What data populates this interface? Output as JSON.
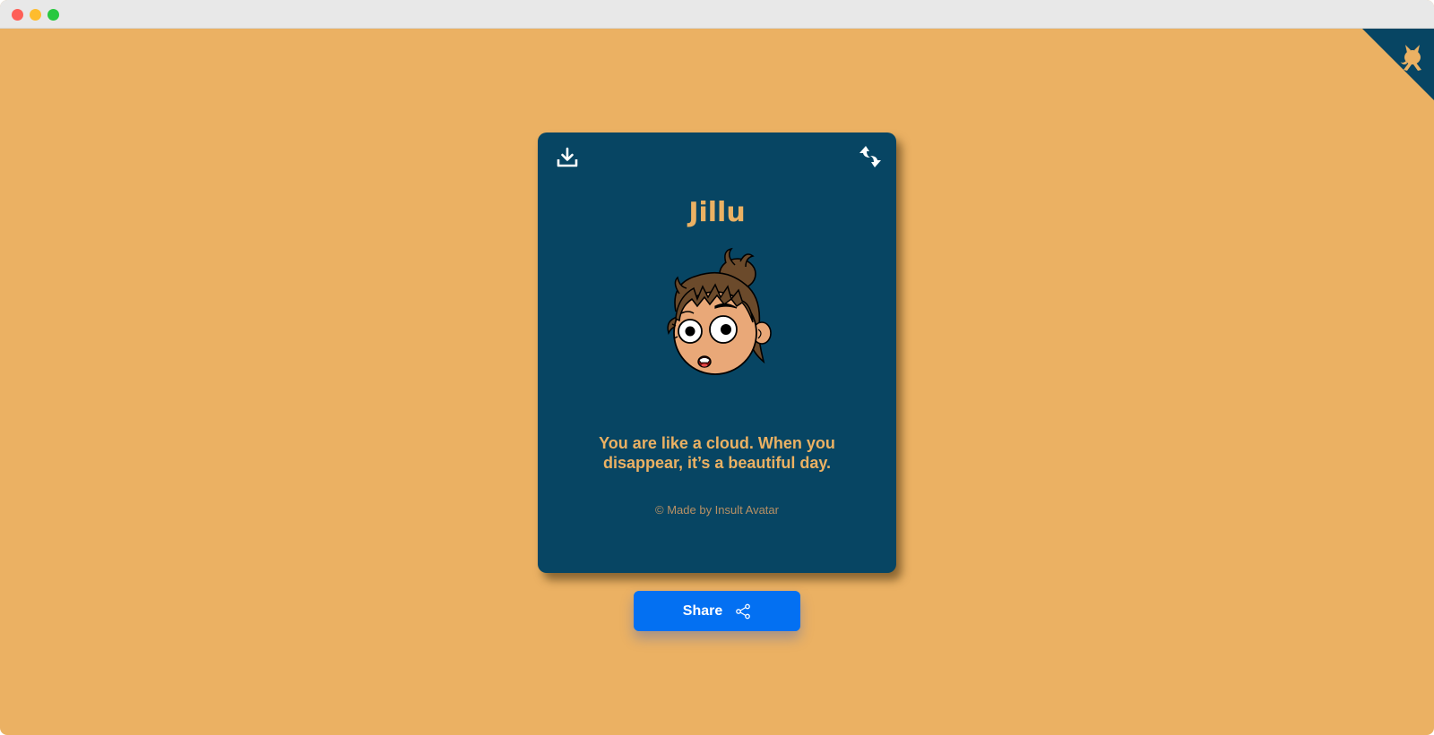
{
  "card": {
    "name": "Jillu",
    "quote": "You are like a cloud. When you disappear, it’s a beautiful day.",
    "credit": "© Made by Insult Avatar"
  },
  "share": {
    "label": "Share"
  },
  "icons": {
    "download": "download-icon",
    "refresh": "refresh-icon",
    "share": "share-icon",
    "github": "github-octocat-icon"
  },
  "colors": {
    "background": "#ebb163",
    "card": "#074563",
    "accent_text": "#ebb163",
    "button": "#0370f2"
  }
}
